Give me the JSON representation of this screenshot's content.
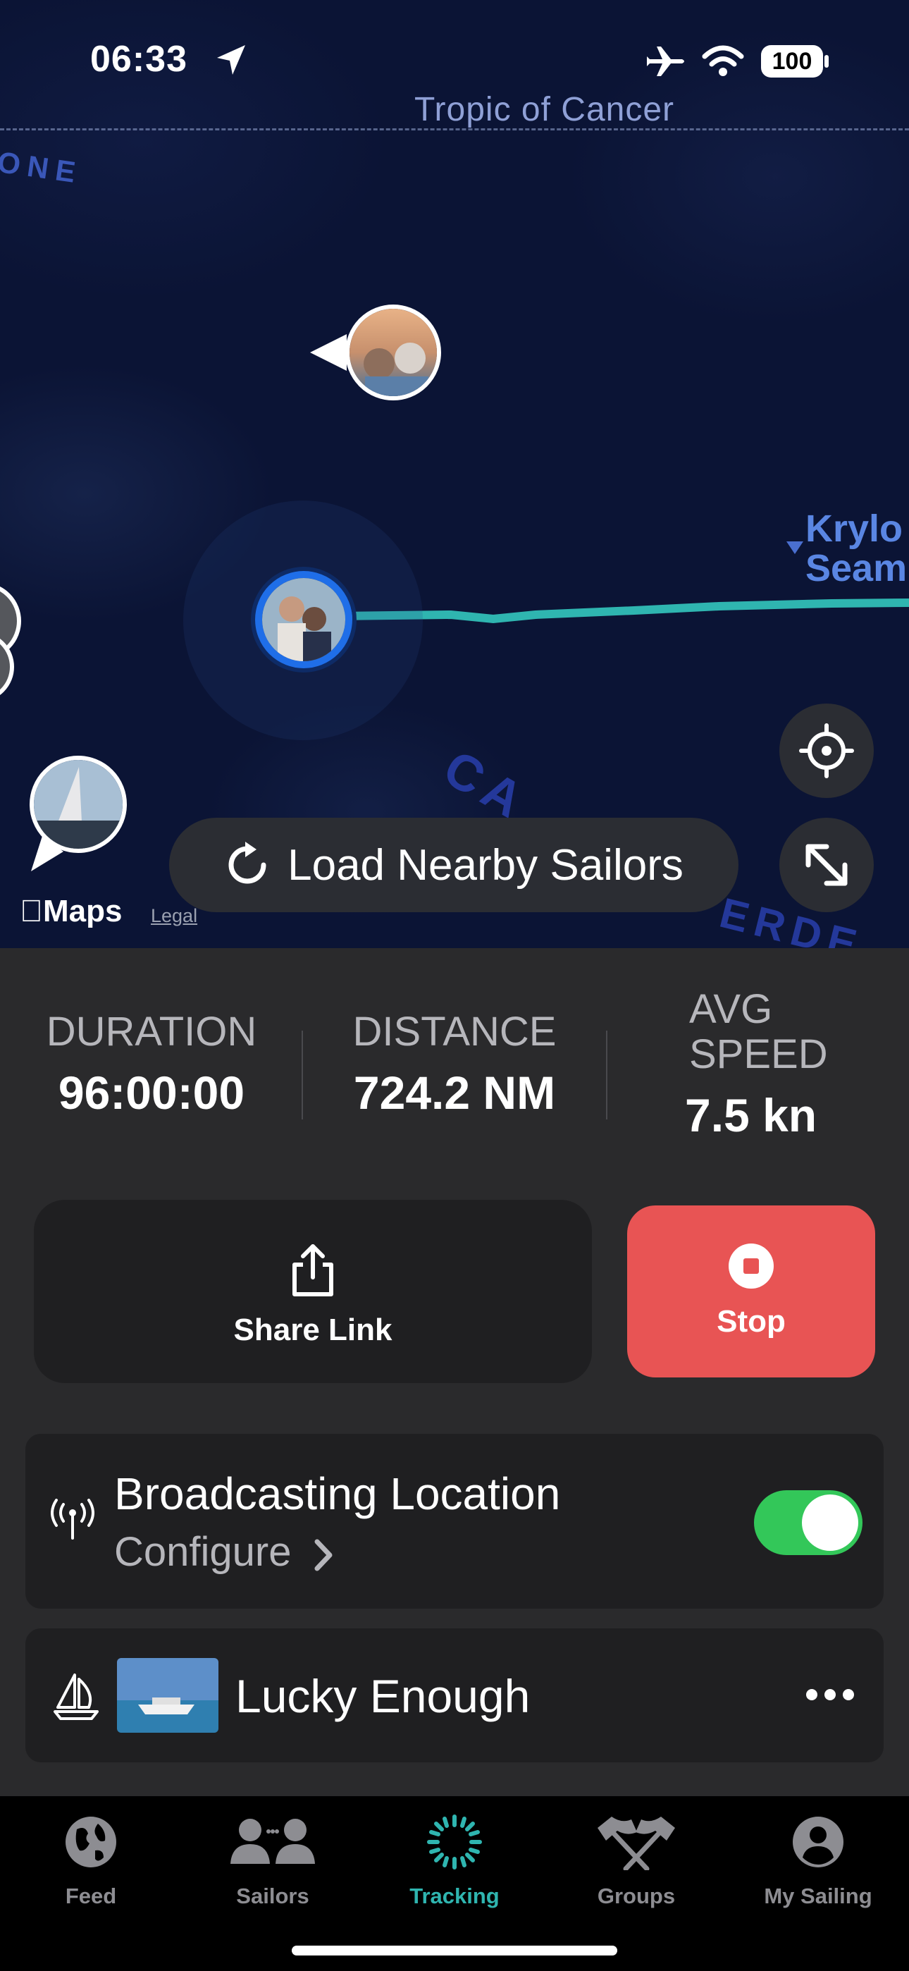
{
  "status_bar": {
    "time": "06:33",
    "battery": "100"
  },
  "map": {
    "tropic_label": "Tropic of Cancer",
    "zone_fragment": "ONE",
    "place_label": "Krylo Seam",
    "place_label_line1": "Krylo",
    "place_label_line2": "Seam",
    "region_fragment_1": "CA",
    "region_fragment_2": "ERDE",
    "provider_label": "Maps",
    "legal_label": "Legal",
    "track_color": "#2fb5b0",
    "load_nearby_label": "Load Nearby Sailors"
  },
  "stats": {
    "duration_label": "DURATION",
    "duration_value": "96:00:00",
    "distance_label": "DISTANCE",
    "distance_value": "724.2 NM",
    "speed_label_line1": "AVG",
    "speed_label_line2": "SPEED",
    "speed_value": "7.5 kn"
  },
  "actions": {
    "share_label": "Share Link",
    "stop_label": "Stop",
    "stop_color": "#e85454"
  },
  "broadcast": {
    "title": "Broadcasting Location",
    "configure_label": "Configure",
    "toggle_on": true,
    "toggle_color": "#33c759"
  },
  "boat": {
    "name": "Lucky Enough"
  },
  "tabbar": {
    "active": "Tracking",
    "active_color": "#2fb5b0",
    "tabs": [
      {
        "label": "Feed",
        "icon": "globe-icon"
      },
      {
        "label": "Sailors",
        "icon": "people-icon"
      },
      {
        "label": "Tracking",
        "icon": "tracking-icon"
      },
      {
        "label": "Groups",
        "icon": "flags-icon"
      },
      {
        "label": "My Sailing",
        "icon": "person-circle-icon"
      }
    ]
  }
}
